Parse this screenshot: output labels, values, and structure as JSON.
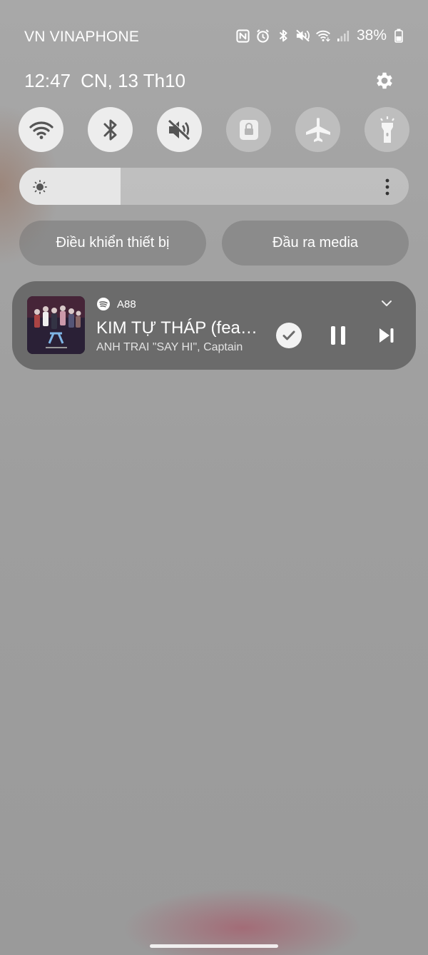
{
  "status_bar": {
    "carrier": "VN VINAPHONE",
    "icons": [
      "nfc-icon",
      "alarm-icon",
      "bluetooth-icon",
      "mute-icon",
      "wifi-icon",
      "signal-icon"
    ],
    "battery_percent": "38%"
  },
  "header": {
    "time": "12:47",
    "date": "CN, 13 Th10"
  },
  "quick_toggles": [
    {
      "name": "wifi",
      "state": "on"
    },
    {
      "name": "bluetooth",
      "state": "on"
    },
    {
      "name": "sound-mute",
      "state": "on"
    },
    {
      "name": "screen-lock",
      "state": "off"
    },
    {
      "name": "airplane-mode",
      "state": "off"
    },
    {
      "name": "flashlight",
      "state": "off"
    }
  ],
  "brightness": {
    "level": 0.26
  },
  "buttons": {
    "device_control": "Điều khiển thiết bị",
    "media_output": "Đầu ra media"
  },
  "media": {
    "app_icon": "spotify-icon",
    "device": "A88",
    "title": "KIM TỰ THÁP (feat....",
    "artist": "ANH TRAI \"SAY HI\", Captain",
    "controls": [
      "check-icon",
      "pause-icon",
      "skip-next-icon"
    ]
  },
  "colors": {
    "toggle_on": "#ededed",
    "card": "#6b6b6b",
    "spotify": "#1db954"
  }
}
